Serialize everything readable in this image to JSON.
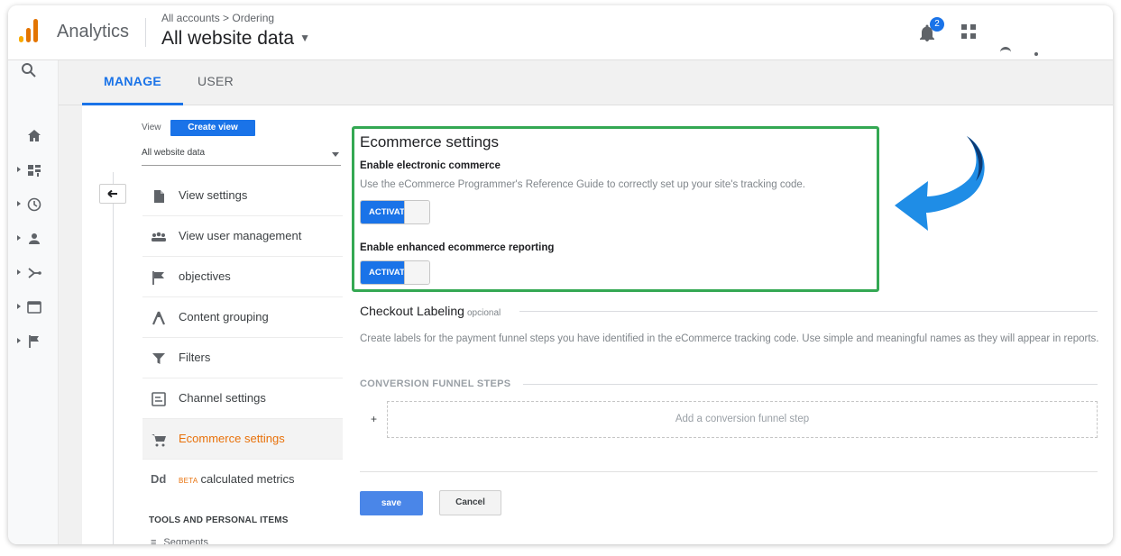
{
  "header": {
    "brand": "Analytics",
    "breadcrumb": "All accounts > Ordering",
    "account": "All website data",
    "notification_count": "2"
  },
  "tabs": [
    {
      "label": "MANAGE",
      "active": true
    },
    {
      "label": "USER",
      "active": false
    }
  ],
  "view": {
    "label": "View",
    "create_button": "Create view",
    "selected": "All website data"
  },
  "menu": [
    {
      "label": "View settings",
      "icon": "document-icon"
    },
    {
      "label": "View user management",
      "icon": "users-icon"
    },
    {
      "label": "objectives",
      "icon": "flag-icon"
    },
    {
      "label": "Content grouping",
      "icon": "grouping-icon"
    },
    {
      "label": "Filters",
      "icon": "filter-icon"
    },
    {
      "label": "Channel settings",
      "icon": "channel-icon"
    },
    {
      "label": "Ecommerce settings",
      "icon": "cart-icon",
      "active": true
    },
    {
      "label": "calculated metrics",
      "badge": "BETA",
      "icon": "dd-icon"
    }
  ],
  "tools_heading": "TOOLS AND PERSONAL ITEMS",
  "segments_partial": "Segments",
  "ecommerce": {
    "title": "Ecommerce settings",
    "enable_label": "Enable electronic commerce",
    "enable_desc": "Use the eCommerce Programmer's Reference Guide to correctly set up your site's tracking code.",
    "toggle1_text": "ACTIVATED",
    "enhanced_label": "Enable enhanced ecommerce reporting",
    "toggle2_text": "ACTIVATED"
  },
  "checkout": {
    "title": "Checkout Labeling",
    "optional": "opcional",
    "desc": "Create labels for the payment funnel steps you have identified in the eCommerce tracking code. Use simple and meaningful names as they will appear in reports.",
    "funnel_heading": "CONVERSION FUNNEL STEPS",
    "plus": "+",
    "add_step": "Add a conversion funnel step"
  },
  "actions": {
    "save": "save",
    "cancel": "Cancel"
  },
  "colors": {
    "accent": "#1a73e8",
    "highlight_box": "#34a853",
    "active_menu": "#e8710a"
  }
}
